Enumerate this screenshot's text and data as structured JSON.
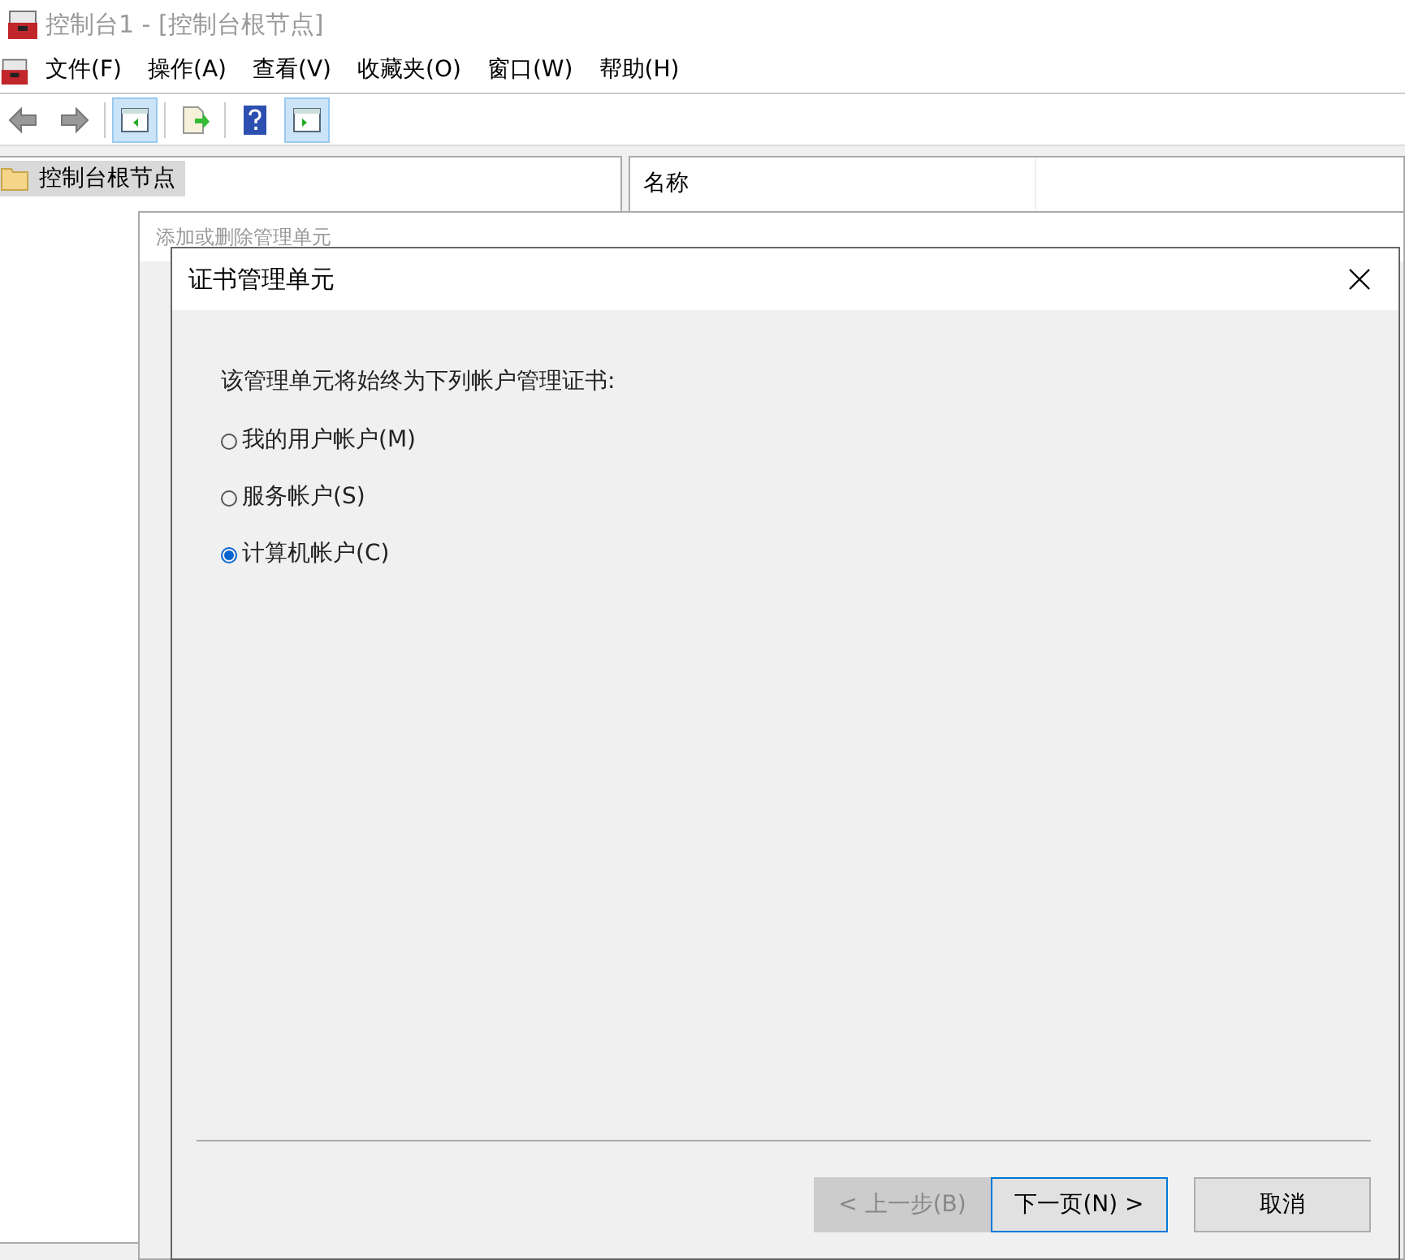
{
  "window": {
    "title": "控制台1 - [控制台根节点]"
  },
  "menu": [
    "文件(F)",
    "操作(A)",
    "查看(V)",
    "收藏夹(O)",
    "窗口(W)",
    "帮助(H)"
  ],
  "toolbar": [
    {
      "kind": "back",
      "active": false
    },
    {
      "kind": "forward",
      "active": false
    },
    {
      "kind": "tree",
      "active": true
    },
    {
      "kind": "export",
      "active": false
    },
    {
      "kind": "help",
      "active": false
    },
    {
      "kind": "action",
      "active": true
    }
  ],
  "tree": {
    "items": [
      {
        "label": "控制台根节点",
        "selected": true
      }
    ]
  },
  "list": {
    "columns": [
      "名称"
    ]
  },
  "background_dialog": {
    "title": "添加或删除管理单元"
  },
  "dialog": {
    "title": "证书管理单元",
    "prompt": "该管理单元将始终为下列帐户管理证书:",
    "options": [
      {
        "label": "我的用户帐户(M)",
        "selected": false
      },
      {
        "label": "服务帐户(S)",
        "selected": false
      },
      {
        "label": "计算机帐户(C)",
        "selected": true
      }
    ],
    "buttons": [
      {
        "label": "< 上一步(B)",
        "disabled": true,
        "focused": false
      },
      {
        "label": "下一页(N) >",
        "disabled": false,
        "focused": true
      },
      {
        "label": "取消",
        "disabled": false,
        "focused": false
      }
    ]
  }
}
